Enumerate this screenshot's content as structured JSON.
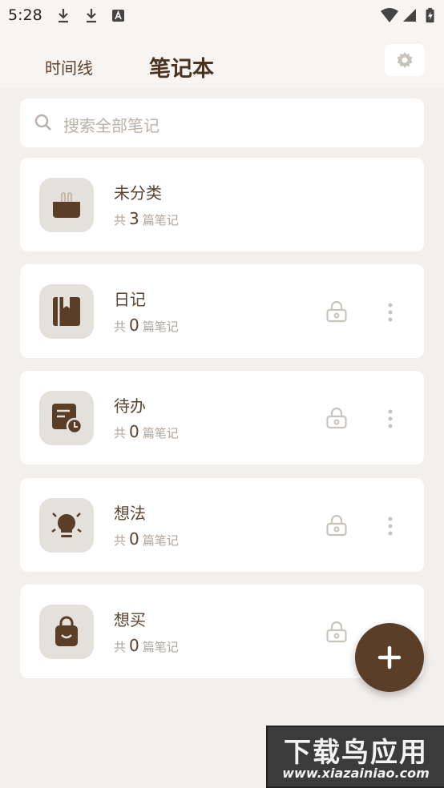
{
  "status_bar": {
    "time": "5:28",
    "icons": [
      "download-icon",
      "download-icon",
      "notification-a-icon",
      "wifi-icon",
      "signal-icon",
      "battery-charging-icon"
    ]
  },
  "header": {
    "tabs": [
      {
        "label": "时间线",
        "active": false
      },
      {
        "label": "笔记本",
        "active": true
      }
    ],
    "settings_icon": "gear-icon"
  },
  "search": {
    "placeholder": "搜索全部笔记",
    "icon": "search-icon"
  },
  "notebooks": [
    {
      "name": "未分类",
      "prefix": "共",
      "count": "3",
      "suffix": "篇笔记",
      "icon": "basket-icon",
      "locked": false,
      "has_menu": false
    },
    {
      "name": "日记",
      "prefix": "共",
      "count": "0",
      "suffix": "篇笔记",
      "icon": "diary-book-icon",
      "locked": true,
      "has_menu": true
    },
    {
      "name": "待办",
      "prefix": "共",
      "count": "0",
      "suffix": "篇笔记",
      "icon": "todo-clock-icon",
      "locked": true,
      "has_menu": true
    },
    {
      "name": "想法",
      "prefix": "共",
      "count": "0",
      "suffix": "篇笔记",
      "icon": "lightbulb-icon",
      "locked": true,
      "has_menu": true
    },
    {
      "name": "想买",
      "prefix": "共",
      "count": "0",
      "suffix": "篇笔记",
      "icon": "shopping-bag-icon",
      "locked": true,
      "has_menu": false
    }
  ],
  "fab": {
    "icon": "plus-icon"
  },
  "watermark": {
    "line1": "下载鸟应用",
    "line2": "www.xiazainiao.com"
  },
  "colors": {
    "background": "#f3efec",
    "card": "#ffffff",
    "icon_box": "#e4e0dc",
    "accent_brown": "#5a3e28",
    "muted_text": "#b1a69d"
  }
}
